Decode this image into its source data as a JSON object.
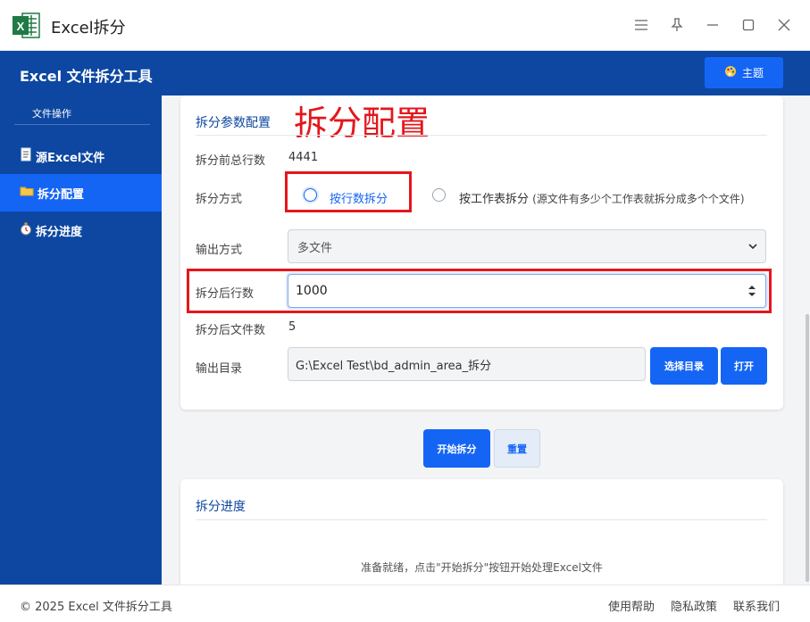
{
  "window": {
    "title": "Excel拆分",
    "app_icon_letter": "X"
  },
  "header": {
    "title": "Excel 文件拆分工具",
    "theme_button": "主题"
  },
  "sidebar": {
    "section_label": "文件操作",
    "items": [
      {
        "label": "源Excel文件",
        "icon": "document-icon",
        "active": false
      },
      {
        "label": "拆分配置",
        "icon": "folder-icon",
        "active": true
      },
      {
        "label": "拆分进度",
        "icon": "stopwatch-icon",
        "active": false
      }
    ]
  },
  "config": {
    "title": "拆分参数配置",
    "annotation": "拆分配置",
    "total_rows_label": "拆分前总行数",
    "total_rows_value": "4441",
    "method_label": "拆分方式",
    "method_options": [
      {
        "label": "按行数拆分",
        "selected": true
      },
      {
        "label": "按工作表拆分",
        "selected": false
      }
    ],
    "method_hint": "(源文件有多少个工作表就拆分成多个个文件)",
    "output_mode_label": "输出方式",
    "output_mode_value": "多文件",
    "rows_after_label": "拆分后行数",
    "rows_after_value": "1000",
    "files_after_label": "拆分后文件数",
    "files_after_value": "5",
    "output_dir_label": "输出目录",
    "output_dir_value": "G:\\Excel Test\\bd_admin_area_拆分",
    "choose_dir_button": "选择目录",
    "open_button": "打开"
  },
  "actions": {
    "start_button": "开始拆分",
    "reset_button": "重置"
  },
  "progress": {
    "title": "拆分进度",
    "status": "准备就绪，点击\"开始拆分\"按钮开始处理Excel文件"
  },
  "footer": {
    "copyright": "© 2025 Excel 文件拆分工具",
    "links": [
      "使用帮助",
      "隐私政策",
      "联系我们"
    ]
  },
  "colors": {
    "primary_dark": "#0d47a1",
    "primary": "#1565f5",
    "annotation_red": "#e4161b",
    "excel_green": "#1f7a45"
  }
}
